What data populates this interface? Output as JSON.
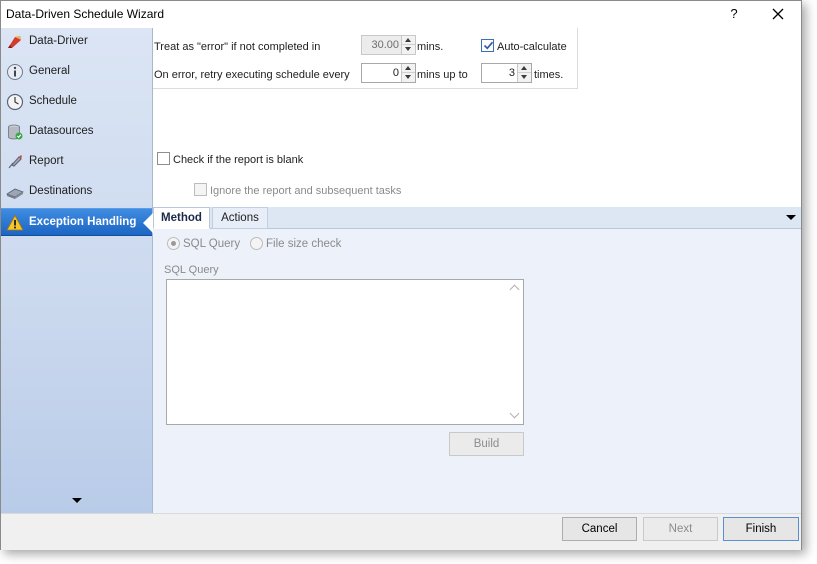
{
  "window": {
    "title": "Data-Driven Schedule Wizard",
    "help_glyph": "?"
  },
  "sidebar": {
    "items": [
      {
        "label": "Data-Driver",
        "icon": "data-driver-icon"
      },
      {
        "label": "General",
        "icon": "info-icon"
      },
      {
        "label": "Schedule",
        "icon": "clock-icon"
      },
      {
        "label": "Datasources",
        "icon": "database-icon"
      },
      {
        "label": "Report",
        "icon": "report-icon"
      },
      {
        "label": "Destinations",
        "icon": "destinations-icon"
      },
      {
        "label": "Exception Handling",
        "icon": "warning-icon",
        "active": true
      }
    ]
  },
  "timeout": {
    "error_label": "Treat as \"error\" if not completed in",
    "error_value": "30.00",
    "error_unit": "mins.",
    "auto_calc_label": "Auto-calculate",
    "auto_calc_checked": true,
    "retry_label": "On error, retry  executing schedule every",
    "retry_value": "0",
    "retry_unit": "mins up to",
    "times_value": "3",
    "times_unit": "times."
  },
  "blank_report": {
    "check_label": "Check if the report is blank",
    "checked": false,
    "ignore_label": "Ignore the report and subsequent tasks",
    "ignore_checked": false
  },
  "tabs": [
    {
      "label": "Method",
      "active": true
    },
    {
      "label": "Actions",
      "active": false
    }
  ],
  "method": {
    "option_sql": "SQL Query",
    "option_size": "File size check",
    "selected": "SQL Query",
    "query_label": "SQL Query",
    "query_value": "",
    "build_label": "Build"
  },
  "footer": {
    "cancel_label": "Cancel",
    "next_label": "Next",
    "finish_label": "Finish"
  },
  "colors": {
    "active_nav": "#1c65c4",
    "sidebar_bg": "#cad8ee",
    "tab_content_bg": "#edf2fa",
    "check_accent": "#3d6fb6"
  }
}
